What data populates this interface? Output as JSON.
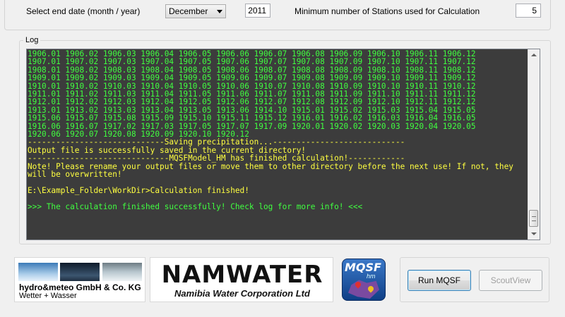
{
  "settings": {
    "end_date_label": "Select end date (month / year)",
    "end_month": "December",
    "end_year": "2011",
    "min_stations_label": "Minimum number of Stations used for Calculation",
    "min_stations": "5"
  },
  "log": {
    "title": "Log",
    "lines": [
      {
        "text": "1906.01 1906.02 1906.03 1906.04 1906.05 1906.06 1906.07 1906.08 1906.09 1906.10 1906.11 1906.12",
        "color": "green"
      },
      {
        "text": "1907.01 1907.02 1907.03 1907.04 1907.05 1907.06 1907.07 1907.08 1907.09 1907.10 1907.11 1907.12",
        "color": "green"
      },
      {
        "text": "1908.01 1908.02 1908.03 1908.04 1908.05 1908.06 1908.07 1908.08 1908.09 1908.10 1908.11 1908.12",
        "color": "green"
      },
      {
        "text": "1909.01 1909.02 1909.03 1909.04 1909.05 1909.06 1909.07 1909.08 1909.09 1909.10 1909.11 1909.12",
        "color": "green"
      },
      {
        "text": "1910.01 1910.02 1910.03 1910.04 1910.05 1910.06 1910.07 1910.08 1910.09 1910.10 1910.11 1910.12",
        "color": "green"
      },
      {
        "text": "1911.01 1911.02 1911.03 1911.04 1911.05 1911.06 1911.07 1911.08 1911.09 1911.10 1911.11 1911.12",
        "color": "green"
      },
      {
        "text": "1912.01 1912.02 1912.03 1912.04 1912.05 1912.06 1912.07 1912.08 1912.09 1912.10 1912.11 1912.12",
        "color": "green"
      },
      {
        "text": "1913.01 1913.02 1913.03 1913.04 1913.05 1913.06 1914.10 1915.01 1915.02 1915.03 1915.04 1915.05",
        "color": "green"
      },
      {
        "text": "1915.06 1915.07 1915.08 1915.09 1915.10 1915.11 1915.12 1916.01 1916.02 1916.03 1916.04 1916.05",
        "color": "green"
      },
      {
        "text": "1916.06 1916.07 1917.02 1917.03 1917.05 1917.07 1917.09 1920.01 1920.02 1920.03 1920.04 1920.05",
        "color": "green"
      },
      {
        "text": "1920.06 1920.07 1920.08 1920.09 1920.10 1920.12",
        "color": "green"
      },
      {
        "text": "-----------------------------Saving precipitation...----------------------------",
        "color": "yellow"
      },
      {
        "text": "Output file is successfully saved in the current directory!",
        "color": "yellow"
      },
      {
        "text": "------------------------------MQSFModel_HM has finished calculation!------------",
        "color": "yellow"
      },
      {
        "text": "Note! Please rename your output files or move them to other directory before the next use! If not, they will be overwritten!",
        "color": "yellow"
      },
      {
        "text": "",
        "color": "yellow"
      },
      {
        "text": "E:\\Example_Folder\\WorkDir>Calculation finished!",
        "color": "yellow"
      },
      {
        "text": "",
        "color": "yellow"
      },
      {
        "text": ">>> The calculation finished successfully! Check log for more info! <<<",
        "color": "green"
      }
    ]
  },
  "footer": {
    "hydromet_name": "hydro&meteo GmbH & Co. KG",
    "hydromet_tagline": "Wetter + Wasser",
    "namwater_name": "NAMWATER",
    "namwater_sub": "Namibia Water Corporation Ltd",
    "mqsf_logo_text": "MQSF",
    "mqsf_logo_sub": "hm",
    "run_button": "Run MQSF",
    "scoutview_button": "ScoutView"
  },
  "colors": {
    "log_background": "#3c3c3c",
    "log_green": "#40ff40",
    "log_yellow": "#ffff40"
  }
}
